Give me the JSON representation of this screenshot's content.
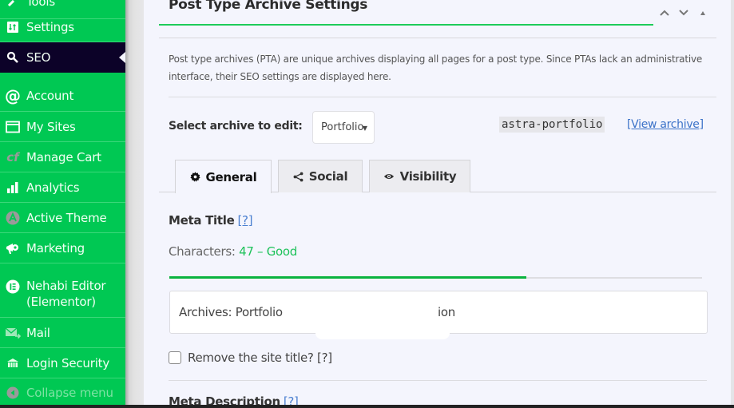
{
  "sidebar": {
    "items": [
      {
        "label": "Tools",
        "icon": "wrench-icon"
      },
      {
        "label": "Settings",
        "icon": "settings-icon"
      },
      {
        "label": "SEO",
        "icon": "search-icon",
        "active": true
      },
      {
        "label": "Account",
        "icon": "at-icon"
      },
      {
        "label": "My Sites",
        "icon": "window-icon"
      },
      {
        "label": "Manage Cart",
        "icon": "cart-icon"
      },
      {
        "label": "Analytics",
        "icon": "bar-chart-icon"
      },
      {
        "label": "Active Theme",
        "icon": "theme-icon"
      },
      {
        "label": "Marketing",
        "icon": "megaphone-icon"
      },
      {
        "label": "Nehabi Editor (Elementor)",
        "icon": "elementor-icon"
      },
      {
        "label": "Mail",
        "icon": "mail-icon"
      },
      {
        "label": "Login Security",
        "icon": "security-icon"
      },
      {
        "label": "Collapse menu",
        "icon": "collapse-icon"
      }
    ]
  },
  "panel": {
    "title": "Post Type Archive Settings",
    "controls": {
      "move_up": "move-up",
      "move_down": "move-down",
      "toggle": "toggle-panel"
    },
    "description": "Post type archives (PTA) are unique archives displaying all pages for a post type. Since PTAs lack an administrative interface, their SEO settings are displayed here.",
    "select_label": "Select archive to edit:",
    "select_value": "Portfolio",
    "slug": "astra-portfolio",
    "view_link": "[View archive]",
    "tabs": [
      {
        "label": "General",
        "icon": "gear-icon",
        "active": true
      },
      {
        "label": "Social",
        "icon": "share-icon"
      },
      {
        "label": "Visibility",
        "icon": "eye-icon"
      }
    ],
    "meta_title": {
      "label": "Meta Title",
      "help": "[?]",
      "chars_prefix": "Characters:",
      "chars_value": "47 – Good",
      "meter_percent": 67,
      "input_visible_start": "Archives: Portfolio",
      "input_visible_end": "ion"
    },
    "remove_site_title": {
      "label": "Remove the site title? [?]",
      "checked": false
    },
    "meta_description": {
      "label": "Meta Description",
      "help": "[?]"
    }
  },
  "colors": {
    "sidebar_bg": "#00c853",
    "sidebar_active_bg": "#0c0228",
    "accent_green": "#1ecc5a",
    "link_blue": "#3b72c8"
  }
}
